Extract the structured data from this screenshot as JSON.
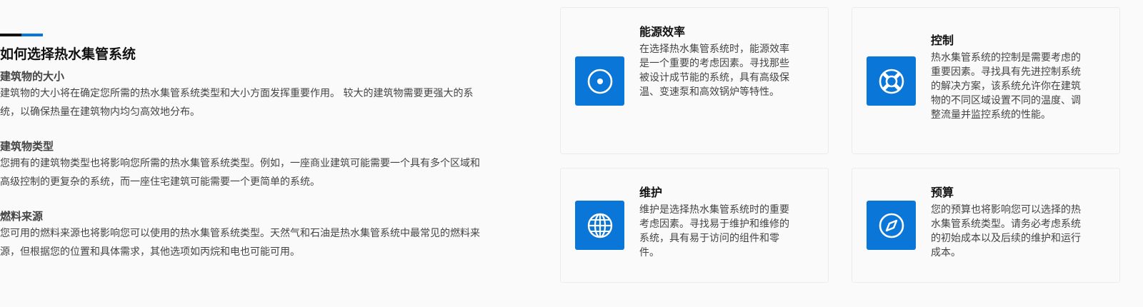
{
  "intro": {
    "title": "如何选择热水集管系统",
    "sections": [
      {
        "heading": "建筑物的大小",
        "line1": "建筑物的大小将在确定您所需的热水集管系统类型和大小方面发挥重要作用。 较大的建筑物需要更强大的系",
        "line2": "统，以确保热量在建筑物内均匀高效地分布。"
      },
      {
        "heading": "建筑物类型",
        "line1": "您拥有的建筑物类型也将影响您所需的热水集管系统类型。例如，一座商业建筑可能需要一个具有多个区域和",
        "line2": "高级控制的更复杂的系统，而一座住宅建筑可能需要一个更简单的系统。"
      },
      {
        "heading": "燃料来源",
        "line1": "您可用的燃料来源也将影响您可以使用的热水集管系统类型。天然气和石油是热水集管系统中最常见的燃料来",
        "line2": "源，但根据您的位置和具体需求，其他选项如丙烷和电也可能可用。"
      }
    ]
  },
  "cards": [
    {
      "title": "能源效率",
      "icon": "target-circle-icon",
      "lines": [
        "在选择热水集管系统时，能源效率",
        "是一个重要的考虑因素。寻找那些",
        "被设计成节能的系统，具有高级保",
        "温、变速泵和高效锅炉等特性。"
      ]
    },
    {
      "title": "控制",
      "icon": "lifebuoy-icon",
      "lines": [
        "热水集管系统的控制是需要考虑的",
        "重要因素。寻找具有先进控制系统",
        "的解决方案，该系统允许你在建筑",
        "物的不同区域设置不同的温度、调",
        "整流量并监控系统的性能。"
      ]
    },
    {
      "title": "维护",
      "icon": "globe-icon",
      "lines": [
        "维护是选择热水集管系统时的重要",
        "考虑因素。寻找易于维护和维修的",
        "系统，具有易于访问的组件和零",
        "件。"
      ]
    },
    {
      "title": "预算",
      "icon": "compass-icon",
      "lines": [
        "您的预算也将影响您可以选择的热",
        "水集管系统类型。请务必考虑系统",
        "的初始成本以及后续的维护和运行",
        "成本。"
      ]
    }
  ],
  "colors": {
    "accent": "#0a76d8",
    "accent_dark": "#111111"
  }
}
